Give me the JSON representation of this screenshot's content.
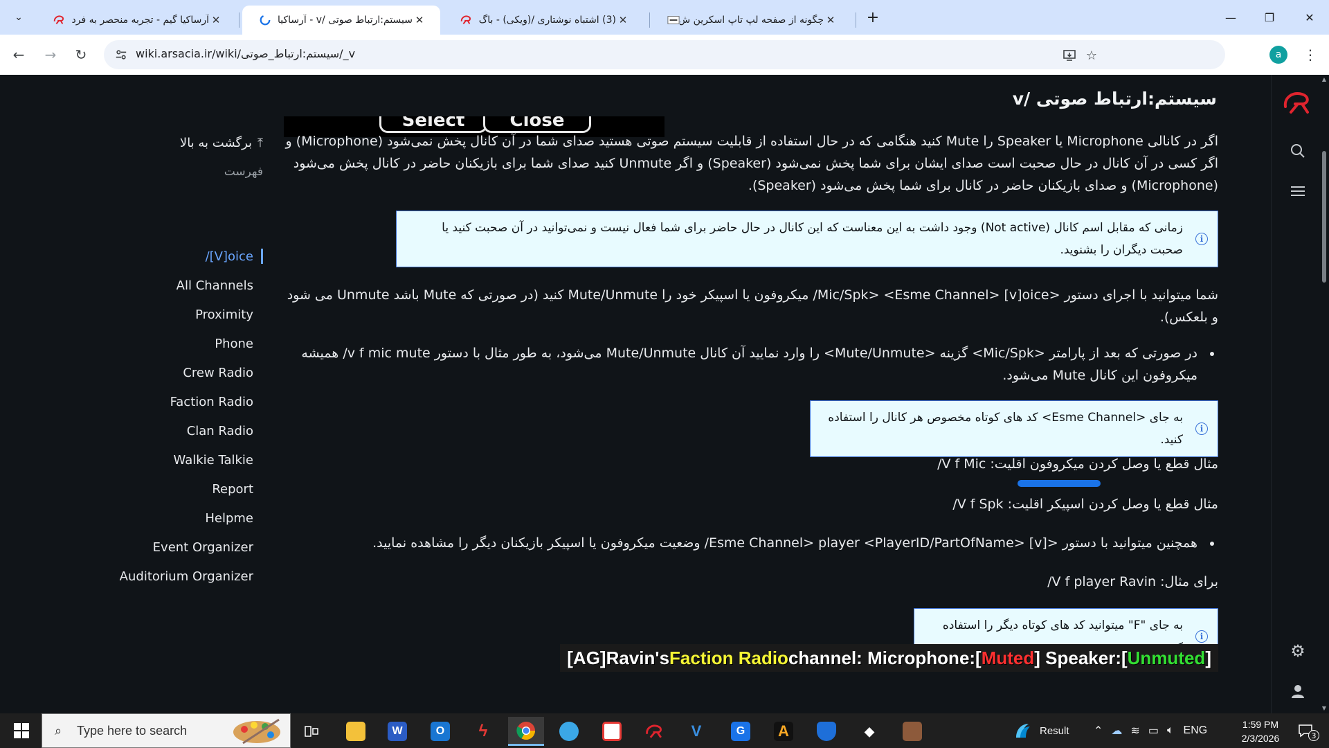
{
  "browser": {
    "tabs": [
      {
        "title": "آرساکیا گیم - تجربه منحصر به فرد",
        "active": false
      },
      {
        "title": "سیستم:ارتباط صوتی /v - آرساکیا",
        "active": true
      },
      {
        "title": "(3) اشتباه نوشتاری /(ویکی) - باگ",
        "active": false
      },
      {
        "title": "چگونه از صفحه لپ تاپ اسکرین ش",
        "active": false
      }
    ],
    "url": "wiki.arsacia.ir/wiki/سیستم:ارتباط_صوتی/_v",
    "profile_initial": "a"
  },
  "page": {
    "title": "سیستم:ارتباط صوتی /v",
    "game_buttons": {
      "select": "Select",
      "close": "Close"
    },
    "intro": "اگر در کانالی Microphone یا Speaker را Mute کنید هنگامی که در حال استفاده از قابلیت سیستم صوتی هستید صدای شما در آن کانال پخش نمی‌شود (Microphone) و اگر کسی در آن کانال در حال صحبت است صدای ایشان برای شما پخش نمی‌شود (Speaker) و اگر Unmute کنید صدای شما برای بازیکنان حاضر در کانال پخش می‌شود (Microphone) و صدای بازیکنان حاضر در کانال برای شما پخش می‌شود (Speaker).",
    "note1": "زمانی که مقابل اسم کانال (Not active) وجود داشت به این معناست که این کانال در حال حاضر برای شما فعال نیست و نمی‌توانید در آن صحبت کنید یا صحبت دیگران را بشنوید.",
    "para2": "شما میتوانید با اجرای دستور <Mic/Spk> <Esme Channel> [v]oice/ میکروفون یا اسپیکر خود را Mute/Unmute کنید (در صورتی که Mute باشد Unmute می شود و بلعکس).",
    "bullet1": "در صورتی که بعد از پارامتر <Mic/Spk> گزینه <Mute/Unmute> را وارد نمایید آن کانال Mute/Unmute می‌شود، به طور مثال با دستور v f mic mute/ همیشه میکروفون این کانال Mute می‌شود.",
    "note2": "به جای <Esme Channel> کد های کوتاه مخصوص هر کانال را استفاده کنید.",
    "example1": "مثال قطع یا وصل کردن میکروفون اقلیت: V f Mic/",
    "example2": "مثال قطع یا وصل کردن اسپیکر اقلیت: V f Spk/",
    "bullet2": "همچنین میتوانید با دستور <Esme Channel> player <PlayerID/PartOfName> [v]/ وضعیت میکروفون یا اسپیکر بازیکنان دیگر را مشاهده نمایید.",
    "example3": "برای مثال: V f player Ravin/",
    "note3": "به جای \"F\" میتوانید کد های کوتاه دیگر را استفاده کنید.",
    "game_line": {
      "part1": "[AG]Ravin's ",
      "part2": "Faction Radio",
      "part3": " channel: Microphone:[",
      "part4": "Muted",
      "part5": "] Speaker:[",
      "part6": "Unmuted",
      "part7": "]",
      "color_yellow": "#f5f535",
      "color_red": "#ff3030",
      "color_green": "#33e033"
    }
  },
  "toc": {
    "back_to_top": "برگشت به بالا",
    "heading": "فهرست",
    "items": [
      {
        "label": "/[V]oice",
        "current": true
      },
      {
        "label": "All Channels"
      },
      {
        "label": "Proximity"
      },
      {
        "label": "Phone"
      },
      {
        "label": "Crew Radio"
      },
      {
        "label": "Faction Radio"
      },
      {
        "label": "Clan Radio"
      },
      {
        "label": "Walkie Talkie"
      },
      {
        "label": "Report"
      },
      {
        "label": "Helpme"
      },
      {
        "label": "Event Organizer"
      },
      {
        "label": "Auditorium Organizer"
      }
    ]
  },
  "taskbar": {
    "search_placeholder": "Type here to search",
    "weather": "Result",
    "language": "ENG",
    "time": "1:59 PM",
    "date": "2/3/2026",
    "notification_count": "3"
  },
  "colors": {
    "accent": "#6aa6ff",
    "brand_red": "#e0242e",
    "note_bg": "#e8fbff"
  }
}
